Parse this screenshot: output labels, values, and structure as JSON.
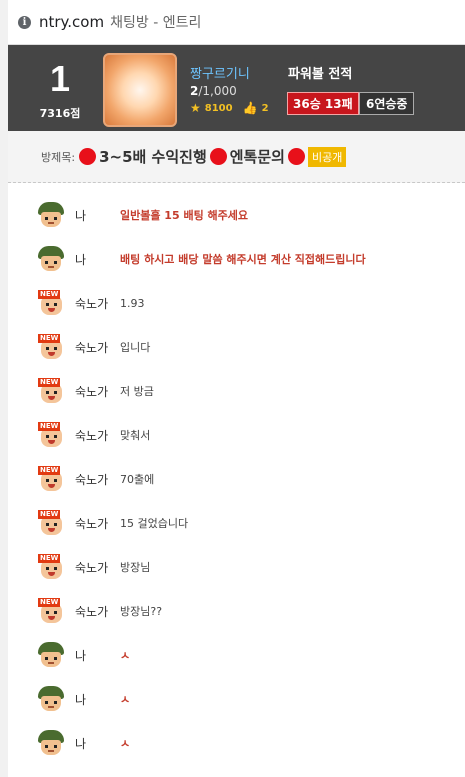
{
  "browser": {
    "site": "ntry.com",
    "page_name": "채팅방 - 엔트리"
  },
  "header": {
    "rank": "1",
    "points": "7316점",
    "nickname": "짱구르기니",
    "room_current": "2",
    "room_max": "/1,000",
    "stars": "8100",
    "likes": "2",
    "powerball_title": "파워볼 전적",
    "record": "36승 13패",
    "streak": "6연승중"
  },
  "room_title": {
    "label": "방제목:",
    "text1": "3~5배 수익진행",
    "text2": "엔톡문의",
    "badge": "비공개"
  },
  "messages": [
    {
      "avatar": "soldier",
      "name": "나",
      "text": "일반볼홀 15 배팅 해주세요",
      "red": true
    },
    {
      "avatar": "soldier",
      "name": "나",
      "text": "배팅 하시고 배당 말씀 해주시면 계산 직접해드립니다",
      "red": true
    },
    {
      "avatar": "new",
      "name": "숙노가",
      "text": "1.93",
      "red": false
    },
    {
      "avatar": "new",
      "name": "숙노가",
      "text": "입니다",
      "red": false
    },
    {
      "avatar": "new",
      "name": "숙노가",
      "text": "저 방금",
      "red": false
    },
    {
      "avatar": "new",
      "name": "숙노가",
      "text": "맞춰서",
      "red": false
    },
    {
      "avatar": "new",
      "name": "숙노가",
      "text": "70출에",
      "red": false
    },
    {
      "avatar": "new",
      "name": "숙노가",
      "text": "15 걸었습니다",
      "red": false
    },
    {
      "avatar": "new",
      "name": "숙노가",
      "text": "방장님",
      "red": false
    },
    {
      "avatar": "new",
      "name": "숙노가",
      "text": "방장님??",
      "red": false
    },
    {
      "avatar": "soldier",
      "name": "나",
      "text": "ㅅ",
      "red": true
    },
    {
      "avatar": "soldier",
      "name": "나",
      "text": "ㅅ",
      "red": true
    },
    {
      "avatar": "soldier",
      "name": "나",
      "text": "ㅅ",
      "red": true
    }
  ],
  "new_tag": "NEW",
  "colors": {
    "header_bg": "#454545",
    "nickname": "#6ec5ff",
    "record_bg": "#c8161d",
    "red_text": "#c43c2c",
    "badge": "#f0b800"
  }
}
